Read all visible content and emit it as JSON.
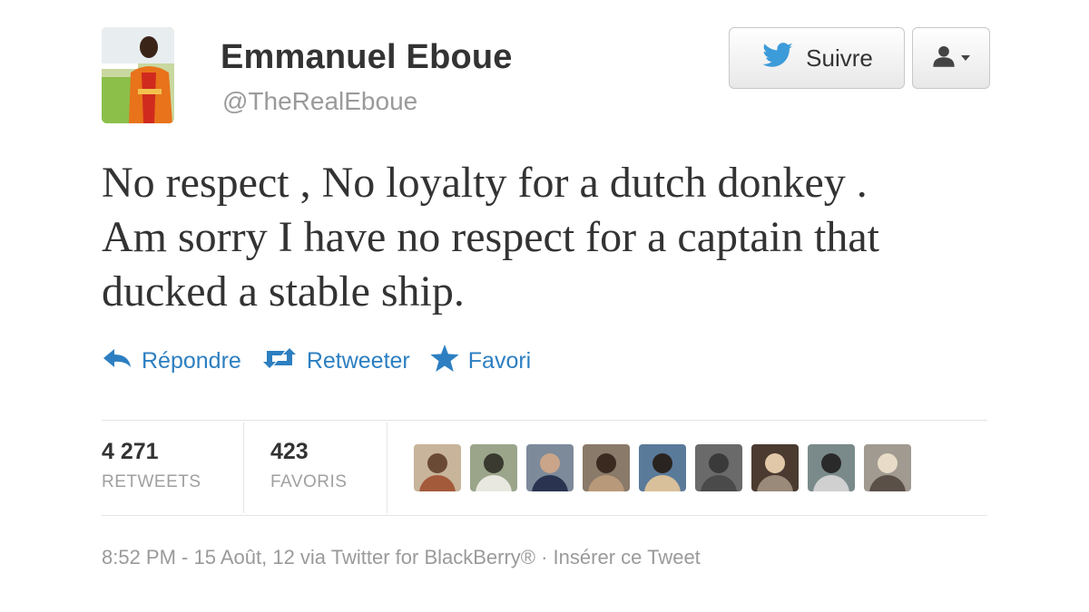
{
  "user": {
    "name": "Emmanuel Eboue",
    "handle": "@TheRealEboue"
  },
  "buttons": {
    "follow_label": "Suivre"
  },
  "tweet": {
    "lines": [
      "No respect , No loyalty for a dutch donkey .",
      "Am sorry I have no respect for a captain that",
      "ducked a stable ship."
    ]
  },
  "actions": {
    "reply": "Répondre",
    "retweet": "Retweeter",
    "favorite": "Favori"
  },
  "stats": {
    "retweets": {
      "count": "4 271",
      "label": "RETWEETS"
    },
    "favorites": {
      "count": "423",
      "label": "FAVORIS"
    }
  },
  "meta": "8:52 PM - 15 Août, 12 via Twitter for BlackBerry® · Insérer ce Tweet",
  "colors": {
    "accent": "#2d7fc1",
    "twitter_bird": "#3c9bd9",
    "muted": "#9a9a9a"
  },
  "icons": [
    "twitter-bird-icon",
    "user-icon",
    "chevron-down-icon",
    "reply-icon",
    "retweet-icon",
    "star-icon"
  ]
}
